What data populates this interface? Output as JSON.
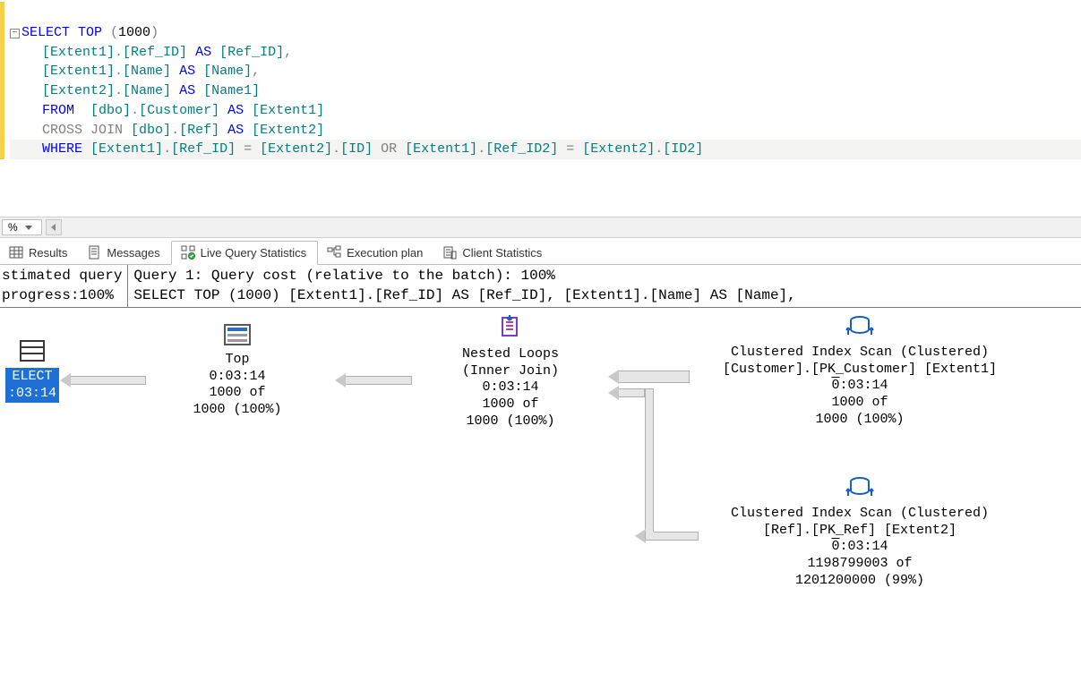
{
  "editor": {
    "outline_minus": "−",
    "line1": {
      "select": "SELECT",
      "top": " TOP ",
      "paren_open": "(",
      "num": "1000",
      "paren_close": ")"
    },
    "line2": "    [Extent1].[Ref_ID] AS [Ref_ID],",
    "line2_parts": {
      "indent": "    ",
      "c1": "[Extent1]",
      "dot1": ".",
      "c2": "[Ref_ID]",
      "as": " AS ",
      "c3": "[Ref_ID]",
      "comma": ","
    },
    "line3_parts": {
      "indent": "    ",
      "c1": "[Extent1]",
      "dot1": ".",
      "c2": "[Name]",
      "as": " AS ",
      "c3": "[Name]",
      "comma": ","
    },
    "line4_parts": {
      "indent": "    ",
      "c1": "[Extent2]",
      "dot1": ".",
      "c2": "[Name]",
      "as": " AS ",
      "c3": "[Name1]"
    },
    "line5_parts": {
      "indent": "    ",
      "from": "FROM",
      "sp": "  ",
      "s1": "[dbo]",
      "dot": ".",
      "s2": "[Customer]",
      "as": " AS ",
      "s3": "[Extent1]"
    },
    "line6_parts": {
      "indent": "    ",
      "join": "CROSS JOIN",
      "sp": " ",
      "s1": "[dbo]",
      "dot": ".",
      "s2": "[Ref]",
      "as": " AS ",
      "s3": "[Extent2]"
    },
    "line7_parts": {
      "indent": "    ",
      "where": "WHERE",
      "sp": " ",
      "a1": "[Extent1]",
      "d1": ".",
      "a2": "[Ref_ID]",
      "eq1": " = ",
      "a3": "[Extent2]",
      "d2": ".",
      "a4": "[ID]",
      "or": " OR ",
      "b1": "[Extent1]",
      "d3": ".",
      "b2": "[Ref_ID2]",
      "eq2": " = ",
      "b3": "[Extent2]",
      "d4": ".",
      "b4": "[ID2]"
    }
  },
  "zoom": {
    "value": "%"
  },
  "tabs": {
    "results": "Results",
    "messages": "Messages",
    "live": "Live Query Statistics",
    "exec": "Execution plan",
    "client": "Client Statistics"
  },
  "plan_header": {
    "left_l1": "stimated query",
    "left_l2": "progress:100%",
    "right_l1": "Query 1: Query cost (relative to the batch): 100%",
    "right_l2": "SELECT TOP (1000)  [Extent1].[Ref_ID] AS [Ref_ID],  [Extent1].[Name] AS [Name],"
  },
  "plan": {
    "select": {
      "label": "ELECT",
      "time": ":03:14"
    },
    "top": {
      "title": "Top",
      "time": "0:03:14",
      "rows1": "1000 of",
      "rows2": "1000 (100%)"
    },
    "nested": {
      "title": "Nested Loops",
      "sub": "(Inner Join)",
      "time": "0:03:14",
      "rows1": "1000 of",
      "rows2": "1000 (100%)"
    },
    "scan1": {
      "title": "Clustered Index Scan (Clustered)",
      "obj": "[Customer].[PK_Customer] [Extent1]",
      "time_prefix": "0",
      "time": ":03:14",
      "rows1": "1000 of",
      "rows2": "1000 (100%)"
    },
    "scan2": {
      "title": "Clustered Index Scan (Clustered)",
      "obj": "[Ref].[PK_Ref] [Extent2]",
      "time_prefix": "0",
      "time": ":03:14",
      "rows1": "1198799003 of",
      "rows2": "1201200000 (99%)"
    }
  }
}
